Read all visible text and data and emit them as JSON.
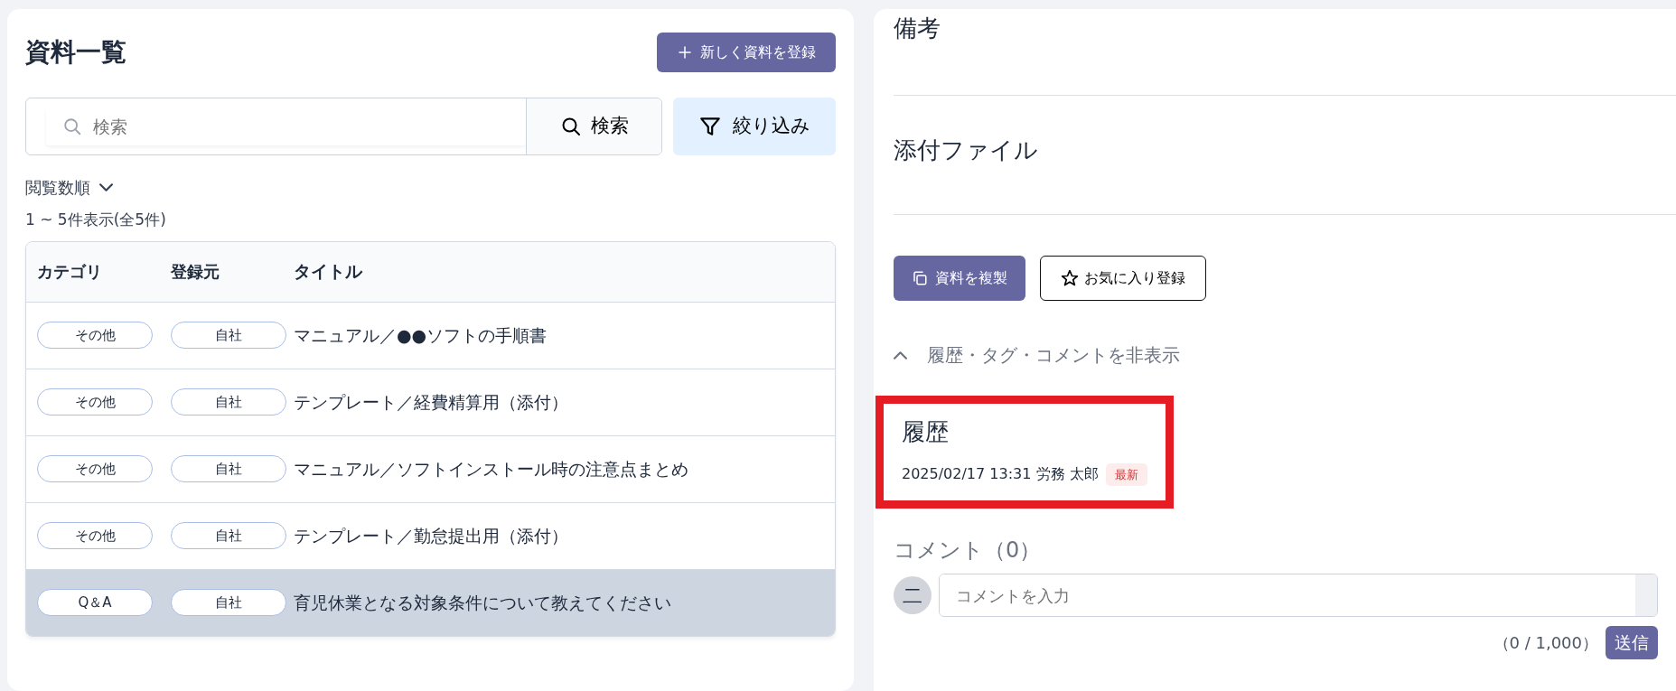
{
  "list_panel": {
    "title": "資料一覧",
    "new_button": "新しく資料を登録",
    "search": {
      "placeholder": "検索",
      "button": "検索"
    },
    "filter_button": "絞り込み",
    "sort": "閲覧数順",
    "count": "1 ~ 5件表示(全5件)",
    "table": {
      "columns": [
        "カテゴリ",
        "登録元",
        "タイトル"
      ],
      "rows": [
        {
          "category": "その他",
          "source": "自社",
          "title": "マニュアル／●●ソフトの手順書",
          "selected": false
        },
        {
          "category": "その他",
          "source": "自社",
          "title": "テンプレート／経費精算用（添付）",
          "selected": false
        },
        {
          "category": "その他",
          "source": "自社",
          "title": "マニュアル／ソフトインストール時の注意点まとめ",
          "selected": false
        },
        {
          "category": "その他",
          "source": "自社",
          "title": "テンプレート／勤怠提出用（添付）",
          "selected": false
        },
        {
          "category": "Q＆A",
          "source": "自社",
          "title": "育児休業となる対象条件について教えてください",
          "selected": true
        }
      ]
    }
  },
  "detail_panel": {
    "sections": [
      "備考",
      "添付ファイル"
    ],
    "duplicate_button": "資料を複製",
    "favorite_button": "お気に入り登録",
    "toggle": {
      "label": "履歴・タグ・コメントを非表示",
      "expanded": true
    },
    "history": {
      "title": "履歴",
      "highlighted": true,
      "entries": [
        {
          "meta": "2025/02/17 13:31 労務 太郎",
          "badge": "最新"
        }
      ]
    },
    "comments": {
      "title": "コメント（0）",
      "avatar": "二",
      "placeholder": "コメントを入力",
      "counter": "（0 / 1,000）",
      "send_button": "送信"
    }
  }
}
